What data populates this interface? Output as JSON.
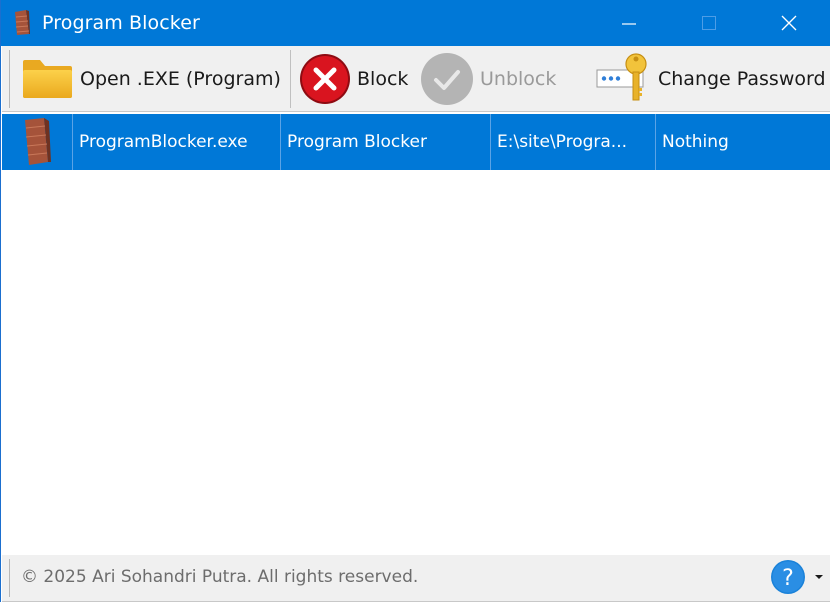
{
  "window": {
    "title": "Program Blocker",
    "controls": {
      "minimize": "minimize",
      "maximize": "maximize",
      "close": "close"
    }
  },
  "toolbar": {
    "open_label": "Open .EXE (Program)",
    "block_label": "Block",
    "unblock_label": "Unblock",
    "change_password_label": "Change Password"
  },
  "list": {
    "rows": [
      {
        "icon": "brick-wall-icon",
        "file_name": "ProgramBlocker.exe",
        "program_name": "Program Blocker",
        "path": "E:\\site\\Progra...",
        "status": "Nothing",
        "selected": true
      }
    ]
  },
  "statusbar": {
    "copyright": "© 2025 Ari Sohandri Putra. All rights reserved."
  },
  "colors": {
    "accent": "#0078d7",
    "block_red": "#d0141e",
    "disabled_gray": "#b5b5b5",
    "folder_yellow": "#f4bf2a"
  }
}
